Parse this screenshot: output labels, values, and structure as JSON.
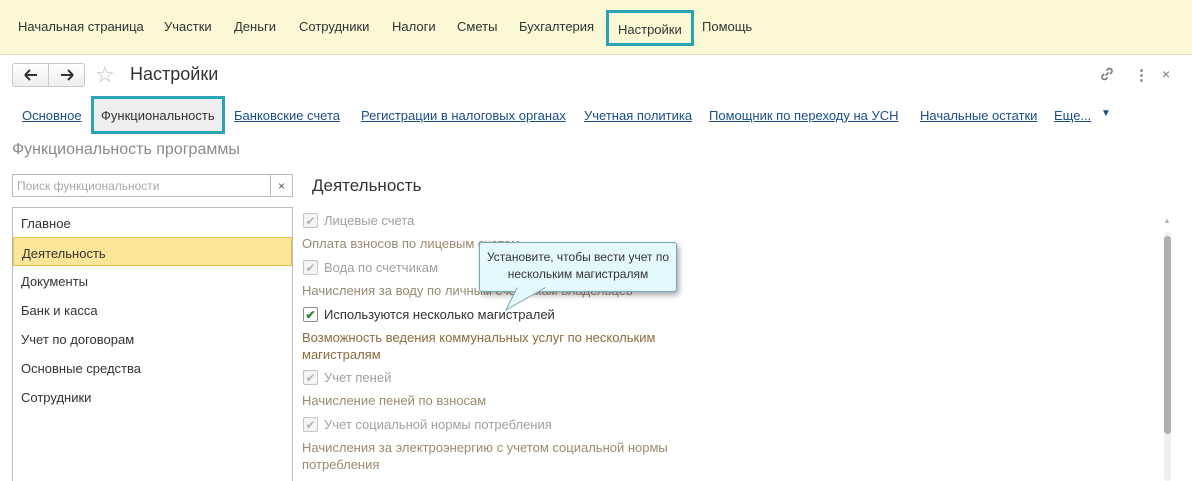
{
  "top_menu": {
    "items": [
      {
        "label": "Начальная страница"
      },
      {
        "label": "Участки"
      },
      {
        "label": "Деньги"
      },
      {
        "label": "Сотрудники"
      },
      {
        "label": "Налоги"
      },
      {
        "label": "Сметы"
      },
      {
        "label": "Бухгалтерия"
      },
      {
        "label": "Настройки"
      },
      {
        "label": "Помощь"
      }
    ],
    "active": "Настройки"
  },
  "window": {
    "title": "Настройки",
    "back_icon": "arrow-left-icon",
    "forward_icon": "arrow-right-icon",
    "favorite_icon": "star-icon",
    "link_icon": "link-icon",
    "more_icon": "more-vertical-icon",
    "close_icon": "close-icon"
  },
  "tabs": {
    "items": [
      {
        "label": "Основное"
      },
      {
        "label": "Функциональность"
      },
      {
        "label": "Банковские счета"
      },
      {
        "label": "Регистрации в налоговых органах"
      },
      {
        "label": "Учетная политика"
      },
      {
        "label": "Помощник по переходу на УСН"
      },
      {
        "label": "Начальные остатки"
      },
      {
        "label": "Еще..."
      }
    ],
    "active": "Функциональность"
  },
  "section_title": "Функциональность программы",
  "search": {
    "placeholder": "Поиск функциональности",
    "value": "",
    "clear_label": "×"
  },
  "categories": {
    "items": [
      {
        "label": "Главное"
      },
      {
        "label": "Деятельность"
      },
      {
        "label": "Документы"
      },
      {
        "label": "Банк и касса"
      },
      {
        "label": "Учет по договорам"
      },
      {
        "label": "Основные средства"
      },
      {
        "label": "Сотрудники"
      }
    ],
    "selected": "Деятельность"
  },
  "activity": {
    "title": "Деятельность",
    "options": [
      {
        "label": "Лицевые счета",
        "description": "Оплата взносов по лицевым счетам",
        "checked": true,
        "enabled": false
      },
      {
        "label": "Вода по счетчикам",
        "description": "Начисления за воду по личным счетчикам владельцев",
        "checked": true,
        "enabled": false
      },
      {
        "label": "Используются несколько магистралей",
        "description": "Возможность ведения коммунальных услуг по нескольким магистралям",
        "checked": true,
        "enabled": true
      },
      {
        "label": "Учет пеней",
        "description": "Начисление пеней по взносам",
        "checked": true,
        "enabled": false
      },
      {
        "label": "Учет социальной нормы потребления",
        "description": "Начисления за электроэнергию с учетом социальной нормы потребления",
        "checked": true,
        "enabled": false
      }
    ]
  },
  "tooltip": {
    "text": "Установите, чтобы вести учет по нескольким магистралям"
  },
  "colors": {
    "highlight_border": "#2aa4b3",
    "selected_row": "#fbe599",
    "menu_bg": "#fbf8d6",
    "link": "#1b4e8a"
  }
}
